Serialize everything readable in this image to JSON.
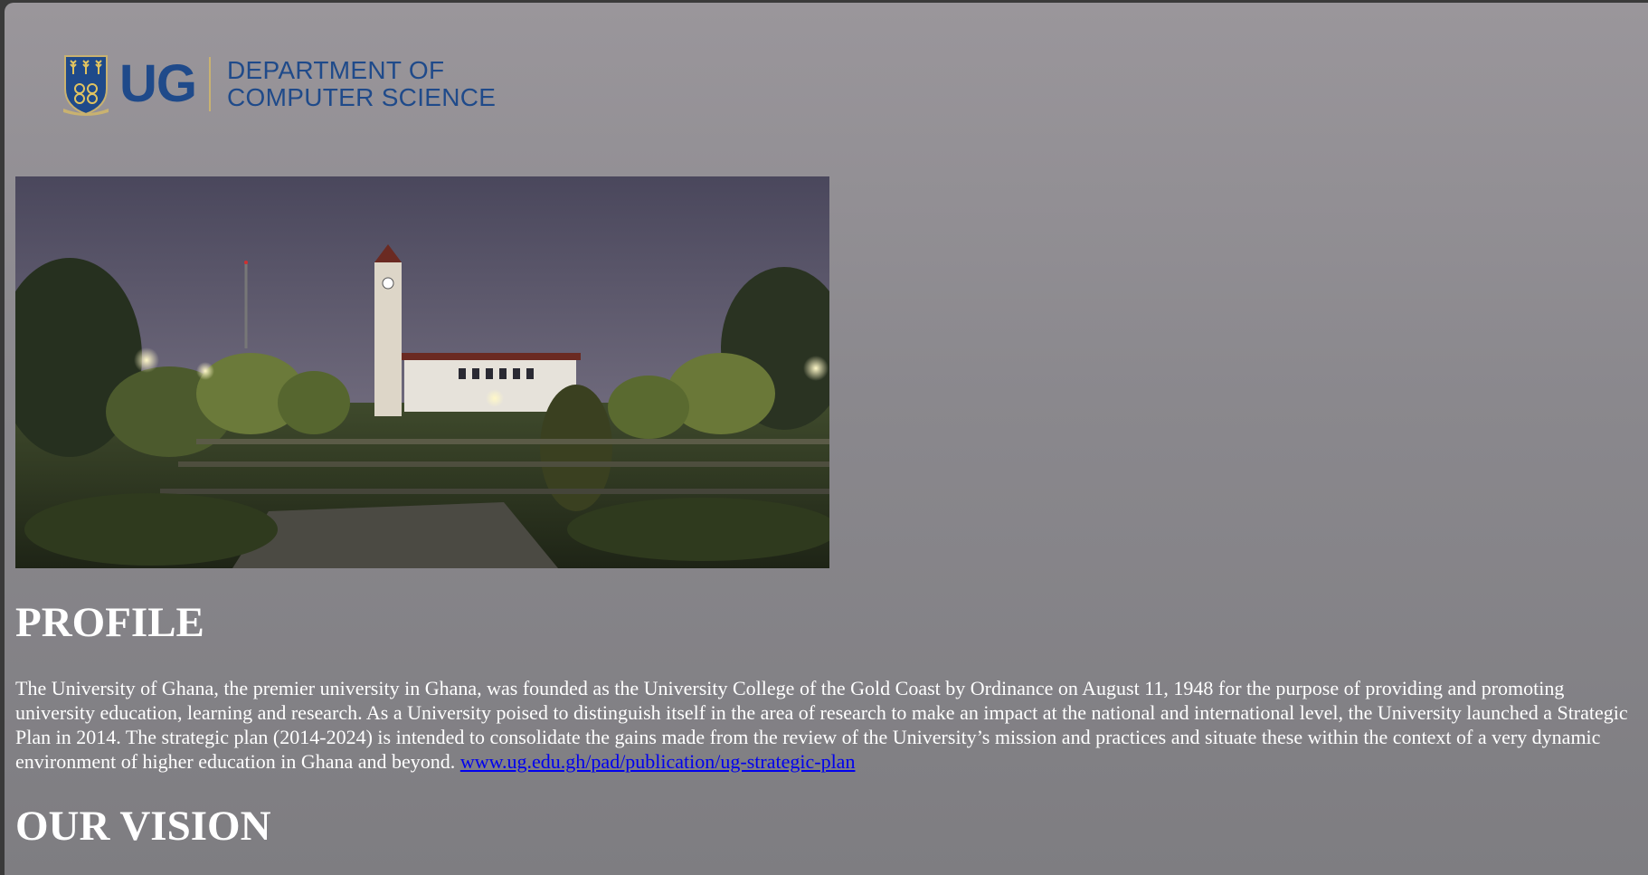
{
  "header": {
    "logo_text": "UG",
    "department_line1": "DEPARTMENT OF",
    "department_line2": "COMPUTER SCIENCE"
  },
  "hero": {
    "image_subject": "campus-clock-tower-at-night"
  },
  "profile": {
    "heading": "PROFILE",
    "body": "The University of Ghana, the premier university in Ghana, was founded as the University College of the Gold Coast by Ordinance on August 11, 1948 for the purpose of providing and promoting university education, learning and research. As a University poised to distinguish itself in the area of research to make an impact at the national and international level, the University launched a Strategic Plan in 2014. The strategic plan (2014-2024) is intended to consolidate the gains made from the review of the University’s mission and practices and situate these within the context of a very dynamic environment of higher education in Ghana and beyond.",
    "link_text": "www.ug.edu.gh/pad/publication/ug-strategic-plan"
  },
  "vision": {
    "heading": "OUR VISION"
  },
  "colors": {
    "brand_blue": "#1f4a8a",
    "gold": "#c9b270",
    "link": "#0000ee",
    "heading": "#ffffff"
  }
}
